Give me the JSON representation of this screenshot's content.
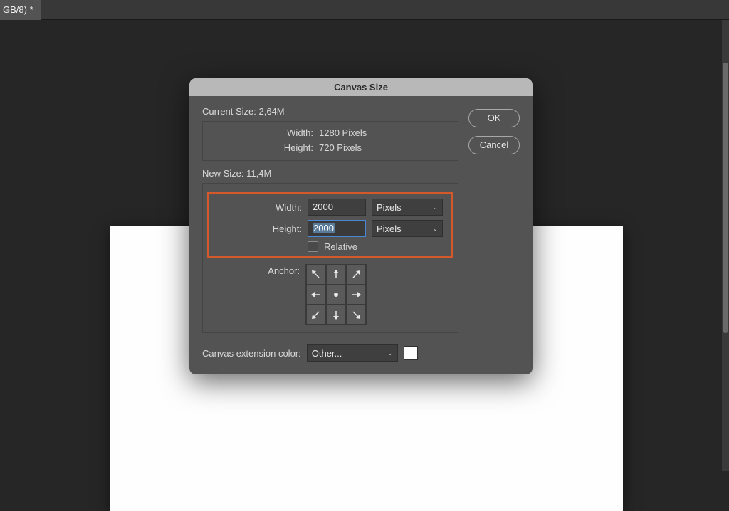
{
  "tab": {
    "label": "GB/8) *"
  },
  "dialog": {
    "title": "Canvas Size",
    "current": {
      "label": "Current Size: 2,64M",
      "width_label": "Width:",
      "width_value": "1280 Pixels",
      "height_label": "Height:",
      "height_value": "720 Pixels"
    },
    "new": {
      "label": "New Size: 11,4M",
      "width_label": "Width:",
      "width_value": "2000",
      "width_unit": "Pixels",
      "height_label": "Height:",
      "height_value": "2000",
      "height_unit": "Pixels",
      "relative_label": "Relative",
      "anchor_label": "Anchor:"
    },
    "extension": {
      "label": "Canvas extension color:",
      "value": "Other...",
      "swatch_color": "#ffffff"
    },
    "buttons": {
      "ok": "OK",
      "cancel": "Cancel"
    }
  }
}
